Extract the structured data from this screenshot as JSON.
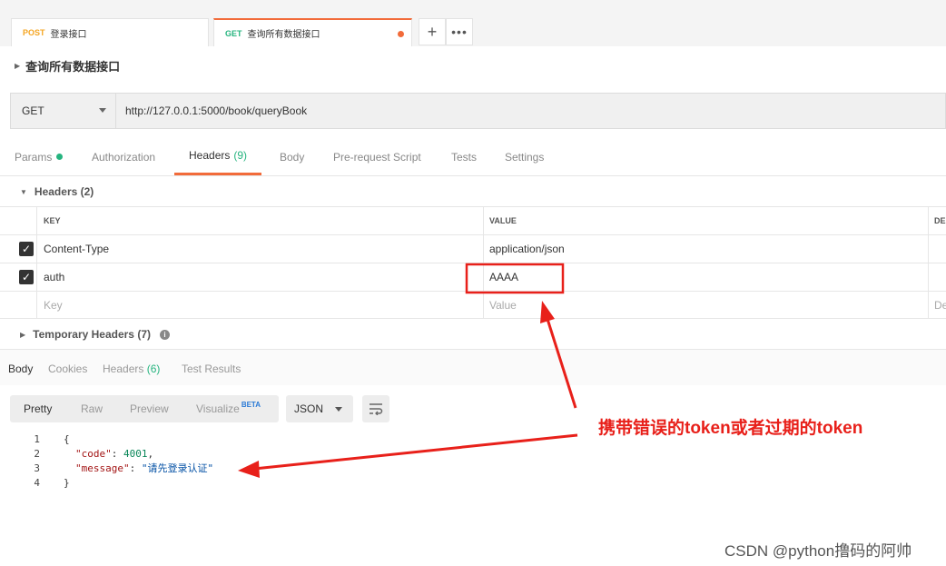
{
  "tabs": [
    {
      "method": "POST",
      "method_color": "#f5a623",
      "name": "登录接口"
    },
    {
      "method": "GET",
      "method_color": "#26b47f",
      "name": "查询所有数据接口"
    }
  ],
  "request_name": "查询所有数据接口",
  "method": "GET",
  "url": "http://127.0.0.1:5000/book/queryBook",
  "config_tabs": {
    "params": "Params",
    "authorization": "Authorization",
    "headers": "Headers",
    "headers_count": "(9)",
    "body": "Body",
    "prerequest": "Pre-request Script",
    "tests": "Tests",
    "settings": "Settings"
  },
  "headers_section": "Headers (2)",
  "table": {
    "col_key": "KEY",
    "col_value": "VALUE",
    "col_desc": "DE",
    "rows": [
      {
        "key": "Content-Type",
        "value": "application/json"
      },
      {
        "key": "auth",
        "value": "AAAA"
      }
    ],
    "key_placeholder": "Key",
    "value_placeholder": "Value",
    "desc_placeholder": "De"
  },
  "temp_headers": "Temporary Headers (7)",
  "response_tabs": {
    "body": "Body",
    "cookies": "Cookies",
    "headers": "Headers",
    "headers_count": "(6)",
    "test_results": "Test Results"
  },
  "view_buttons": {
    "pretty": "Pretty",
    "raw": "Raw",
    "preview": "Preview",
    "visualize": "Visualize",
    "beta": "BETA"
  },
  "format": "JSON",
  "code": {
    "line_numbers": [
      "1",
      "2",
      "3",
      "4"
    ],
    "open": "{",
    "key1": "\"code\"",
    "val1": "4001",
    "key2": "\"message\"",
    "val2": "\"请先登录认证\"",
    "close": "}"
  },
  "annotation": "携带错误的token或者过期的token",
  "watermark": "CSDN @python撸码的阿帅",
  "colors": {
    "accent": "#f26b3a",
    "green": "#26b47f",
    "annotation_red": "#e8201a"
  }
}
